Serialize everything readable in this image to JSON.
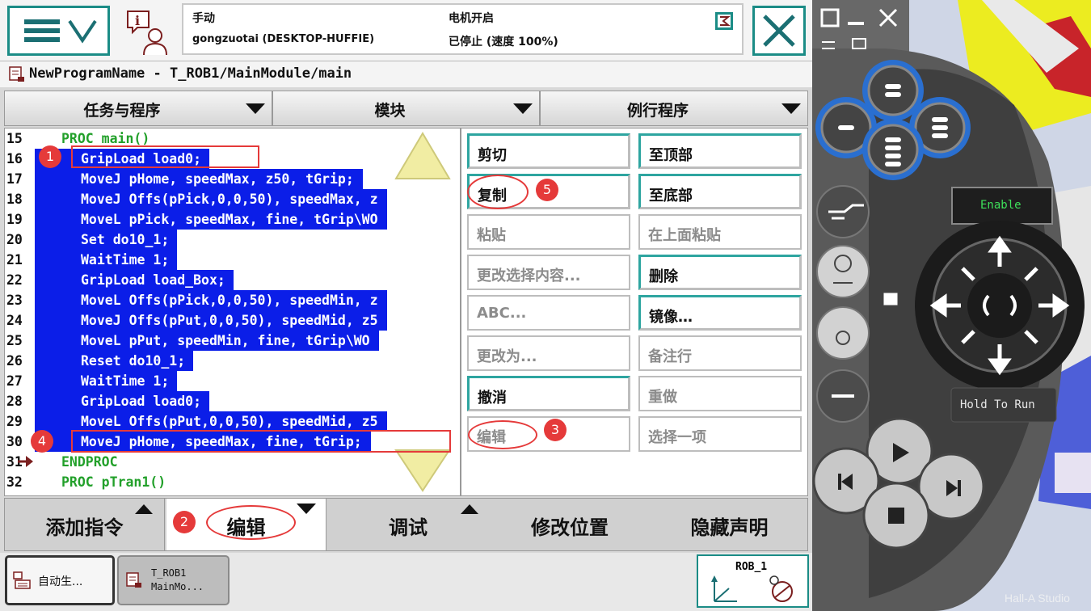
{
  "status": {
    "mode": "手动",
    "controller": "gongzuotai (DESKTOP-HUFFIE)",
    "motor_state": "电机开启",
    "run_state": "已停止 (速度 100%)"
  },
  "path": "NewProgramName - T_ROB1/MainModule/main",
  "tabs": [
    {
      "label": "任务与程序"
    },
    {
      "label": "模块"
    },
    {
      "label": "例行程序"
    }
  ],
  "code_lines": [
    {
      "num": "15",
      "text": "PROC main()",
      "style": "keyword"
    },
    {
      "num": "16",
      "text": "GripLoad load0;",
      "style": "sel"
    },
    {
      "num": "17",
      "text": "MoveJ pHome, speedMax, z50, tGrip;",
      "style": "sel"
    },
    {
      "num": "18",
      "text": "MoveJ Offs(pPick,0,0,50), speedMax, z",
      "style": "sel"
    },
    {
      "num": "19",
      "text": "MoveL pPick, speedMax, fine, tGrip\\WO",
      "style": "sel"
    },
    {
      "num": "20",
      "text": "Set do10_1;",
      "style": "sel"
    },
    {
      "num": "21",
      "text": "WaitTime 1;",
      "style": "sel"
    },
    {
      "num": "22",
      "text": "GripLoad load_Box;",
      "style": "sel"
    },
    {
      "num": "23",
      "text": "MoveL Offs(pPick,0,0,50), speedMin, z",
      "style": "sel"
    },
    {
      "num": "24",
      "text": "MoveJ Offs(pPut,0,0,50), speedMid, z5",
      "style": "sel"
    },
    {
      "num": "25",
      "text": "MoveL pPut, speedMin, fine, tGrip\\WO",
      "style": "sel"
    },
    {
      "num": "26",
      "text": "Reset do10_1;",
      "style": "sel"
    },
    {
      "num": "27",
      "text": "WaitTime 1;",
      "style": "sel"
    },
    {
      "num": "28",
      "text": "GripLoad load0;",
      "style": "sel"
    },
    {
      "num": "29",
      "text": "MoveL Offs(pPut,0,0,50), speedMid, z5",
      "style": "sel"
    },
    {
      "num": "30",
      "text": "MoveJ pHome, speedMax, fine, tGrip;",
      "style": "sel"
    },
    {
      "num": "31",
      "text": "ENDPROC",
      "style": "keyword"
    },
    {
      "num": "32",
      "text": "PROC pTran1()",
      "style": "keyword"
    }
  ],
  "edit_menu": [
    {
      "label": "剪切",
      "enabled": true
    },
    {
      "label": "至顶部",
      "enabled": true
    },
    {
      "label": "复制",
      "enabled": true
    },
    {
      "label": "至底部",
      "enabled": true
    },
    {
      "label": "粘贴",
      "enabled": false
    },
    {
      "label": "在上面粘贴",
      "enabled": false
    },
    {
      "label": "更改选择内容...",
      "enabled": false
    },
    {
      "label": "删除",
      "enabled": true
    },
    {
      "label": "ABC...",
      "enabled": false
    },
    {
      "label": "镜像…",
      "enabled": true
    },
    {
      "label": "更改为...",
      "enabled": false
    },
    {
      "label": "备注行",
      "enabled": false
    },
    {
      "label": "撤消",
      "enabled": true
    },
    {
      "label": "重做",
      "enabled": false
    },
    {
      "label": "编辑",
      "enabled": false
    },
    {
      "label": "选择一项",
      "enabled": false
    }
  ],
  "bottom_bar": {
    "add_instruction": "添加指令",
    "edit": "编辑",
    "debug": "调试",
    "modify_position": "修改位置",
    "hide_declarations": "隐藏声明"
  },
  "taskbar": {
    "item1": "自动生...",
    "item2_line1": "T_ROB1",
    "item2_line2": "MainMo...",
    "robot": "ROB_1"
  },
  "annotations": [
    "1",
    "2",
    "3",
    "4",
    "5"
  ],
  "device": {
    "enable_label": "Enable",
    "hold_to_run": "Hold To Run"
  },
  "watermark": "Hall-A Studio",
  "colors": {
    "selection": "#0b1ee8",
    "keyword": "#22a02a",
    "accent": "#1b8c86",
    "annotation": "#e53a3a"
  }
}
